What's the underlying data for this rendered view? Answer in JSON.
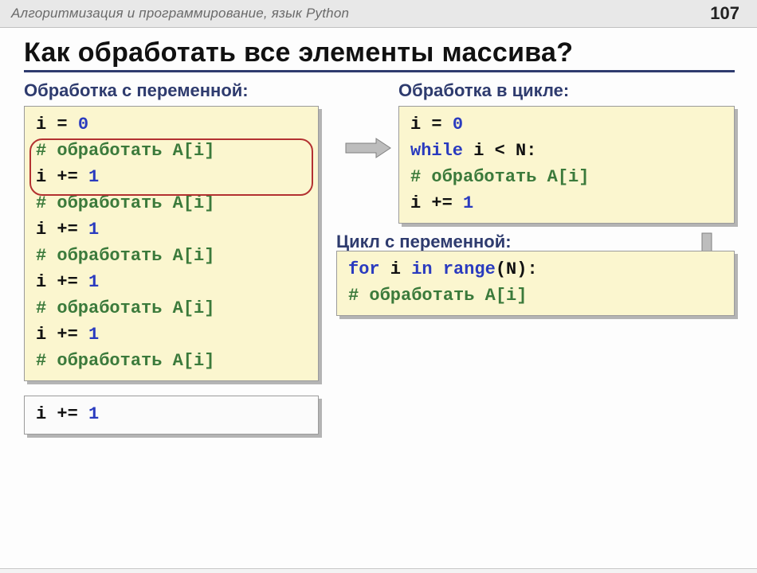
{
  "header": {
    "breadcrumb": "Алгоритмизация и программирование, язык Python",
    "page_number": "107"
  },
  "title": "Как обработать все элементы массива?",
  "left": {
    "heading": "Обработка с переменной:",
    "code_lines": [
      [
        {
          "t": "default",
          "v": "i = "
        },
        {
          "t": "lit",
          "v": "0"
        }
      ],
      [
        {
          "t": "comment",
          "v": "# обработать A[i]"
        }
      ],
      [
        {
          "t": "default",
          "v": "i += "
        },
        {
          "t": "lit",
          "v": "1"
        }
      ],
      [
        {
          "t": "comment",
          "v": "# обработать A[i]"
        }
      ],
      [
        {
          "t": "default",
          "v": "i += "
        },
        {
          "t": "lit",
          "v": "1"
        }
      ],
      [
        {
          "t": "comment",
          "v": "# обработать A[i]"
        }
      ],
      [
        {
          "t": "default",
          "v": "i += "
        },
        {
          "t": "lit",
          "v": "1"
        }
      ],
      [
        {
          "t": "comment",
          "v": "# обработать A[i]"
        }
      ],
      [
        {
          "t": "default",
          "v": "i += "
        },
        {
          "t": "lit",
          "v": "1"
        }
      ],
      [
        {
          "t": "comment",
          "v": "# обработать A[i]"
        }
      ]
    ],
    "extra_line": [
      {
        "t": "default",
        "v": "i += "
      },
      {
        "t": "lit",
        "v": "1"
      }
    ]
  },
  "right": {
    "heading1": "Обработка в цикле:",
    "code1_lines": [
      [
        {
          "t": "default",
          "v": "i = "
        },
        {
          "t": "lit",
          "v": "0"
        }
      ],
      [
        {
          "t": "keyword",
          "v": "while"
        },
        {
          "t": "default",
          "v": "  i < N:"
        }
      ],
      [
        {
          "t": "default",
          "v": "   "
        },
        {
          "t": "comment",
          "v": "# обработать A[i]"
        }
      ],
      [
        {
          "t": "default",
          "v": "   i += "
        },
        {
          "t": "lit",
          "v": "1"
        }
      ]
    ],
    "heading2": "Цикл с переменной:",
    "code2_lines": [
      [
        {
          "t": "keyword",
          "v": "for"
        },
        {
          "t": "default",
          "v": " i "
        },
        {
          "t": "keyword",
          "v": "in"
        },
        {
          "t": "default",
          "v": " "
        },
        {
          "t": "func",
          "v": "range"
        },
        {
          "t": "default",
          "v": "(N):"
        }
      ],
      [
        {
          "t": "default",
          "v": "   "
        },
        {
          "t": "comment",
          "v": "# обработать A[i]"
        }
      ]
    ]
  },
  "icons": {
    "arrow_right": "arrow-right-icon",
    "arrow_down": "arrow-down-icon"
  }
}
